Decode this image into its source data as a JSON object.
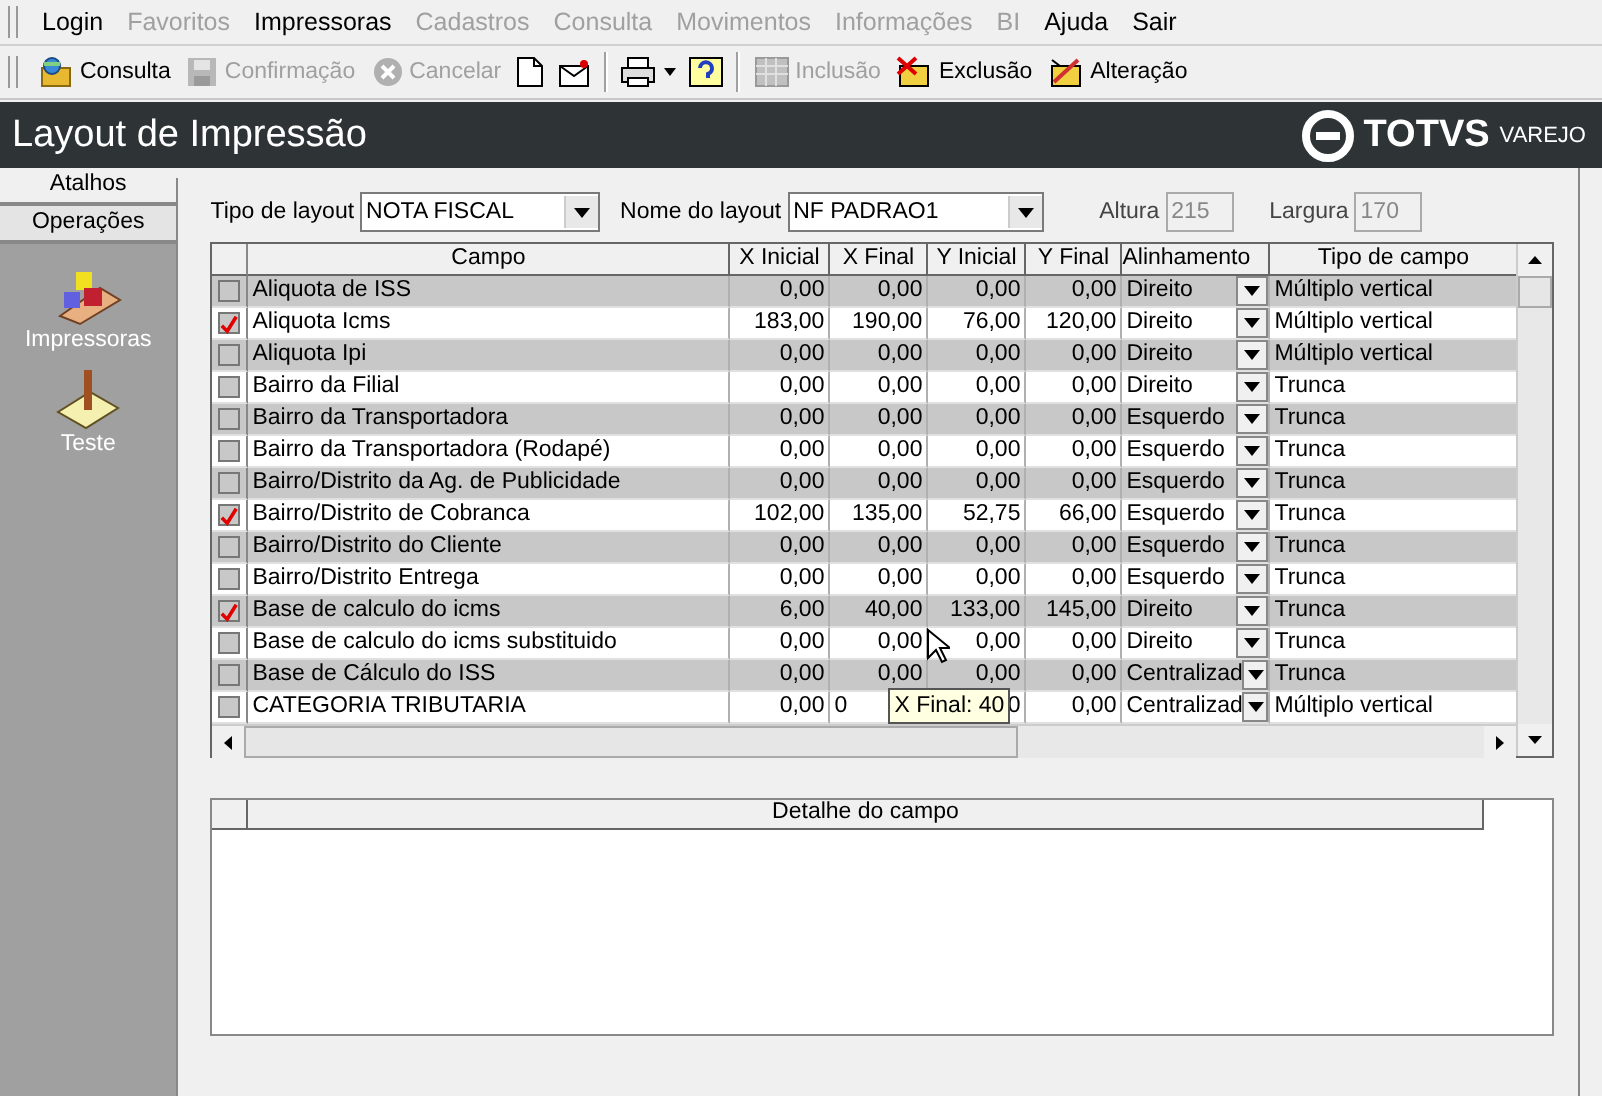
{
  "menu": [
    {
      "label": "Login",
      "disabled": false
    },
    {
      "label": "Favoritos",
      "disabled": true
    },
    {
      "label": "Impressoras",
      "disabled": false
    },
    {
      "label": "Cadastros",
      "disabled": true
    },
    {
      "label": "Consulta",
      "disabled": true
    },
    {
      "label": "Movimentos",
      "disabled": true
    },
    {
      "label": "Informações",
      "disabled": true
    },
    {
      "label": "BI",
      "disabled": true
    },
    {
      "label": "Ajuda",
      "disabled": false
    },
    {
      "label": "Sair",
      "disabled": false
    }
  ],
  "toolbar": [
    {
      "kind": "text",
      "label": "Consulta",
      "disabled": false
    },
    {
      "kind": "text",
      "label": "Confirmação",
      "disabled": true
    },
    {
      "kind": "text",
      "label": "Cancelar",
      "disabled": true
    },
    {
      "kind": "icon"
    },
    {
      "kind": "icon"
    },
    {
      "kind": "sep"
    },
    {
      "kind": "icon",
      "dropdown": true
    },
    {
      "kind": "icon"
    },
    {
      "kind": "sep"
    },
    {
      "kind": "text",
      "label": "Inclusão",
      "disabled": true
    },
    {
      "kind": "text",
      "label": "Exclusão",
      "disabled": false
    },
    {
      "kind": "text",
      "label": "Alteração",
      "disabled": false
    }
  ],
  "header": {
    "title": "Layout de Impressão",
    "brand": "TOTVS",
    "brand_sub": "VAREJO"
  },
  "sidebar": {
    "tabs": [
      {
        "label": "Atalhos",
        "selected": false
      },
      {
        "label": "Operações",
        "selected": true
      }
    ],
    "items": [
      {
        "label": "Impressoras"
      },
      {
        "label": "Teste"
      }
    ]
  },
  "form": {
    "tipo_label": "Tipo de layout",
    "tipo_value": "NOTA FISCAL",
    "nome_label": "Nome do layout",
    "nome_value": "NF PADRAO1",
    "altura_label": "Altura",
    "altura_value": "215",
    "largura_label": "Largura",
    "largura_value": "170"
  },
  "table": {
    "columns": [
      "Campo",
      "X Inicial",
      "X Final",
      "Y Inicial",
      "Y Final",
      "Alinhamento",
      "Tipo de campo"
    ],
    "rows": [
      {
        "checked": false,
        "campo": "Aliquota de ISS",
        "x_inicial": "0,00",
        "x_final": "0,00",
        "y_inicial": "0,00",
        "y_final": "0,00",
        "alinhamento": "Direito",
        "tipo": "Múltiplo vertical"
      },
      {
        "checked": true,
        "campo": "Aliquota Icms",
        "x_inicial": "183,00",
        "x_final": "190,00",
        "y_inicial": "76,00",
        "y_final": "120,00",
        "alinhamento": "Direito",
        "tipo": "Múltiplo vertical"
      },
      {
        "checked": false,
        "campo": "Aliquota Ipi",
        "x_inicial": "0,00",
        "x_final": "0,00",
        "y_inicial": "0,00",
        "y_final": "0,00",
        "alinhamento": "Direito",
        "tipo": "Múltiplo vertical"
      },
      {
        "checked": false,
        "campo": "Bairro da Filial",
        "x_inicial": "0,00",
        "x_final": "0,00",
        "y_inicial": "0,00",
        "y_final": "0,00",
        "alinhamento": "Direito",
        "tipo": "Trunca"
      },
      {
        "checked": false,
        "campo": "Bairro da Transportadora",
        "x_inicial": "0,00",
        "x_final": "0,00",
        "y_inicial": "0,00",
        "y_final": "0,00",
        "alinhamento": "Esquerdo",
        "tipo": "Trunca"
      },
      {
        "checked": false,
        "campo": "Bairro da Transportadora (Rodapé)",
        "x_inicial": "0,00",
        "x_final": "0,00",
        "y_inicial": "0,00",
        "y_final": "0,00",
        "alinhamento": "Esquerdo",
        "tipo": "Trunca"
      },
      {
        "checked": false,
        "campo": "Bairro/Distrito da Ag. de Publicidade",
        "x_inicial": "0,00",
        "x_final": "0,00",
        "y_inicial": "0,00",
        "y_final": "0,00",
        "alinhamento": "Esquerdo",
        "tipo": "Trunca"
      },
      {
        "checked": true,
        "campo": "Bairro/Distrito de Cobranca",
        "x_inicial": "102,00",
        "x_final": "135,00",
        "y_inicial": "52,75",
        "y_final": "66,00",
        "alinhamento": "Esquerdo",
        "tipo": "Trunca"
      },
      {
        "checked": false,
        "campo": "Bairro/Distrito do Cliente",
        "x_inicial": "0,00",
        "x_final": "0,00",
        "y_inicial": "0,00",
        "y_final": "0,00",
        "alinhamento": "Esquerdo",
        "tipo": "Trunca"
      },
      {
        "checked": false,
        "campo": "Bairro/Distrito Entrega",
        "x_inicial": "0,00",
        "x_final": "0,00",
        "y_inicial": "0,00",
        "y_final": "0,00",
        "alinhamento": "Esquerdo",
        "tipo": "Trunca"
      },
      {
        "checked": true,
        "campo": "Base de calculo do icms",
        "x_inicial": "6,00",
        "x_final": "40,00",
        "y_inicial": "133,00",
        "y_final": "145,00",
        "alinhamento": "Direito",
        "tipo": "Trunca"
      },
      {
        "checked": false,
        "campo": "Base de calculo do icms substituido",
        "x_inicial": "0,00",
        "x_final": "0,00",
        "y_inicial": "0,00",
        "y_final": "0,00",
        "alinhamento": "Direito",
        "tipo": "Trunca"
      },
      {
        "checked": false,
        "campo": "Base de Cálculo do ISS",
        "x_inicial": "0,00",
        "x_final": "0,00",
        "y_inicial": "0,00",
        "y_final": "0,00",
        "alinhamento": "Centralizad",
        "tipo": "Trunca"
      },
      {
        "checked": false,
        "campo": "CATEGORIA TRIBUTARIA",
        "x_inicial": "0,00",
        "x_final": "0",
        "y_inicial": "0",
        "y_final": "0,00",
        "alinhamento": "Centralizad",
        "tipo": "Múltiplo vertical"
      }
    ],
    "tooltip": {
      "text": "X Final: 40"
    }
  },
  "detail": {
    "title": "Detalhe do campo"
  }
}
